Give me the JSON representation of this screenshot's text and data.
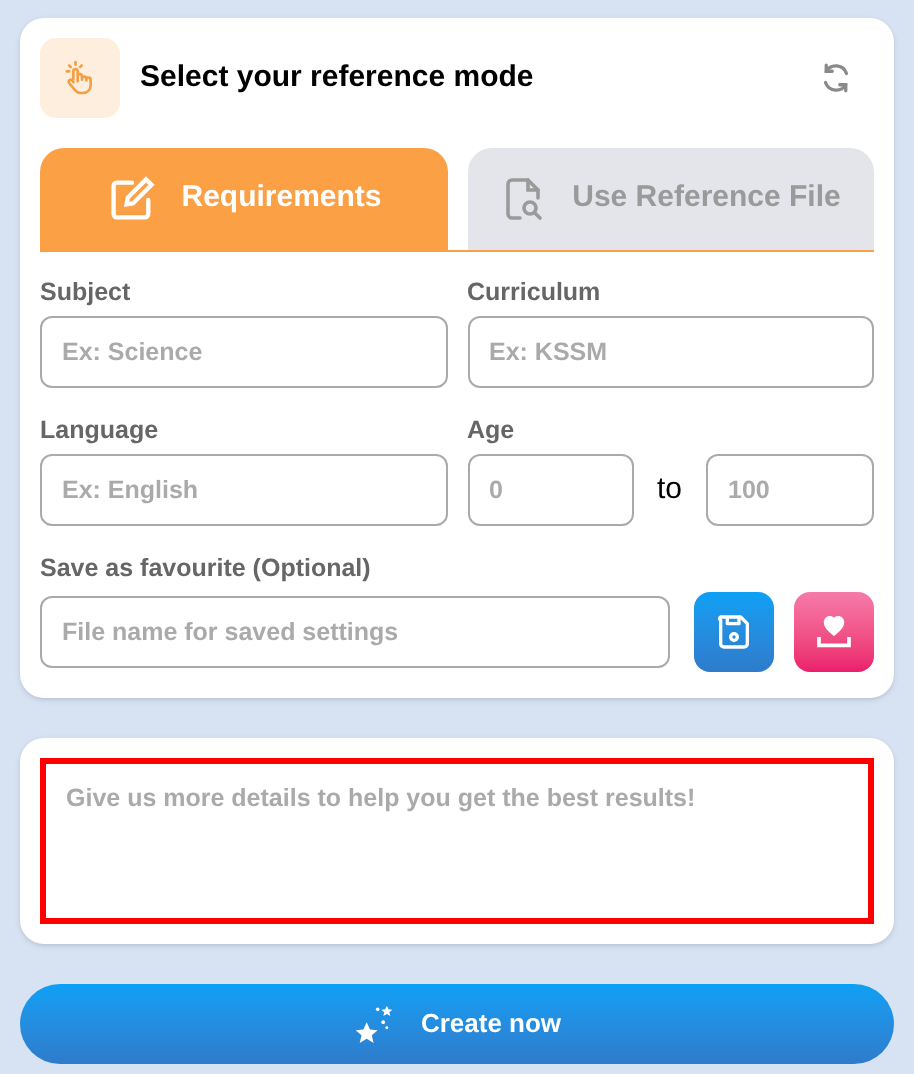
{
  "header": {
    "title": "Select your reference mode"
  },
  "tabs": [
    {
      "label": "Requirements",
      "selected": true
    },
    {
      "label": "Use Reference File",
      "selected": false
    }
  ],
  "fields": {
    "subject": {
      "label": "Subject",
      "placeholder": "Ex: Science"
    },
    "curriculum": {
      "label": "Curriculum",
      "placeholder": "Ex: KSSM"
    },
    "language": {
      "label": "Language",
      "placeholder": "Ex: English"
    },
    "age": {
      "label": "Age",
      "from_placeholder": "0",
      "separator": "to",
      "to_placeholder": "100"
    },
    "favourite": {
      "label": "Save as favourite (Optional)",
      "placeholder": "File name for saved settings"
    }
  },
  "details": {
    "placeholder": "Give us more details to help you get the best results!",
    "highlighted": true
  },
  "create_button": {
    "label": "Create now"
  }
}
